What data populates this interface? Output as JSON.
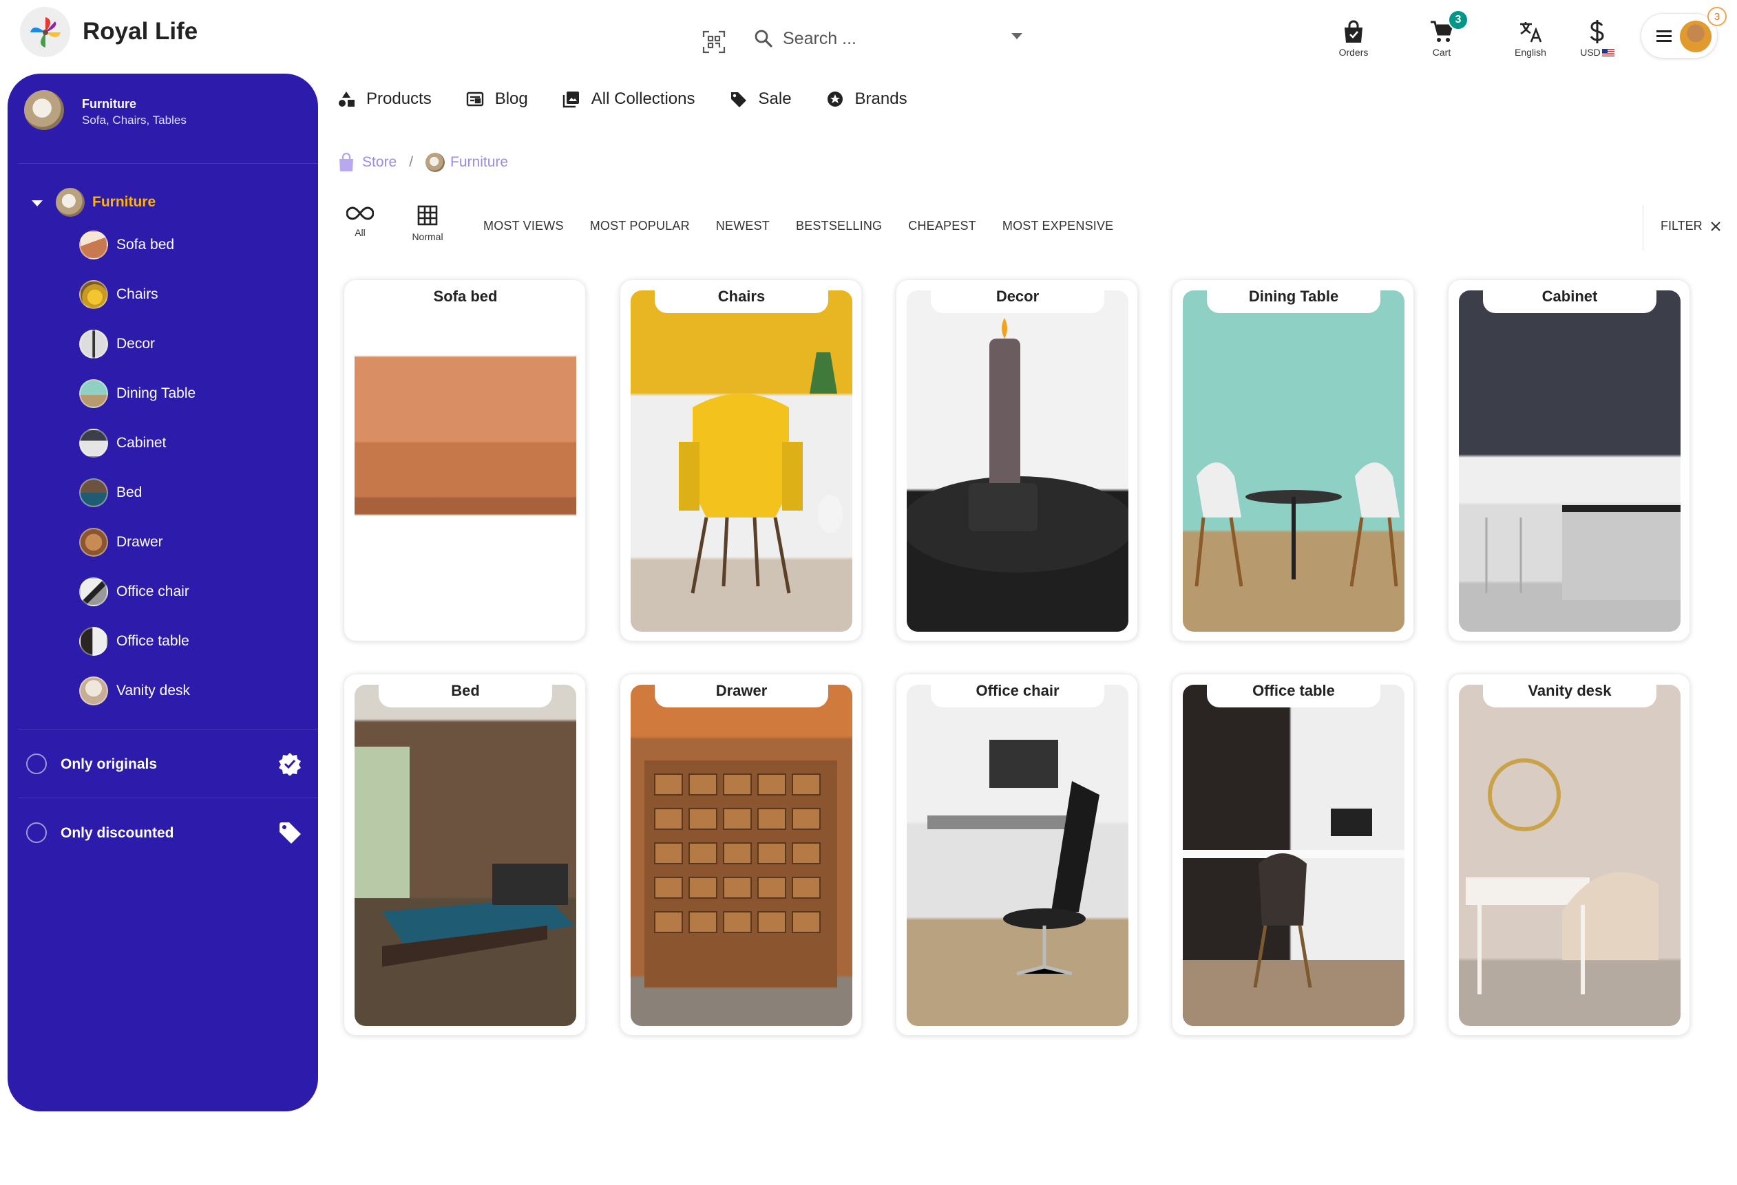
{
  "header": {
    "app_name": "Royal Life",
    "search_placeholder": "Search ...",
    "tools": [
      {
        "label": "Orders",
        "icon": "shopping-bag-icon"
      },
      {
        "label": "Cart",
        "icon": "cart-icon",
        "badge": "3"
      },
      {
        "label": "English",
        "icon": "translate-icon"
      },
      {
        "label": "USD",
        "icon": "dollar-icon",
        "flag": "us-flag-icon"
      }
    ],
    "notification_count": "3"
  },
  "sidebar": {
    "category_title": "Furniture",
    "category_subtitle": "Sofa, Chairs, Tables",
    "parent_label": "Furniture",
    "items": [
      {
        "label": "Sofa bed"
      },
      {
        "label": "Chairs"
      },
      {
        "label": "Decor"
      },
      {
        "label": "Dining Table"
      },
      {
        "label": "Cabinet"
      },
      {
        "label": "Bed"
      },
      {
        "label": "Drawer"
      },
      {
        "label": "Office chair"
      },
      {
        "label": "Office table"
      },
      {
        "label": "Vanity desk"
      }
    ],
    "only_originals_label": "Only originals",
    "only_discounted_label": "Only discounted"
  },
  "nav": {
    "items": [
      {
        "label": "Products",
        "icon": "shapes-icon"
      },
      {
        "label": "Blog",
        "icon": "newspaper-icon"
      },
      {
        "label": "All Collections",
        "icon": "collections-icon"
      },
      {
        "label": "Sale",
        "icon": "tag-icon"
      },
      {
        "label": "Brands",
        "icon": "star-badge-icon"
      }
    ]
  },
  "breadcrumb": {
    "store": "Store",
    "separator": "/",
    "current": "Furniture"
  },
  "sortbar": {
    "view_all_label": "All",
    "view_normal_label": "Normal",
    "sorts": [
      "MOST VIEWS",
      "MOST POPULAR",
      "NEWEST",
      "BESTSELLING",
      "CHEAPEST",
      "MOST EXPENSIVE"
    ],
    "filter_label": "FILTER"
  },
  "cards": [
    {
      "title": "Sofa bed"
    },
    {
      "title": "Chairs"
    },
    {
      "title": "Decor"
    },
    {
      "title": "Dining Table"
    },
    {
      "title": "Cabinet"
    },
    {
      "title": "Bed"
    },
    {
      "title": "Drawer"
    },
    {
      "title": "Office chair"
    },
    {
      "title": "Office table"
    },
    {
      "title": "Vanity desk"
    }
  ],
  "colors": {
    "sidebar_bg": "#2d1bab",
    "sidebar_active": "#ffb300",
    "breadcrumb": "#9b8ae6",
    "cart_badge": "#009688"
  }
}
